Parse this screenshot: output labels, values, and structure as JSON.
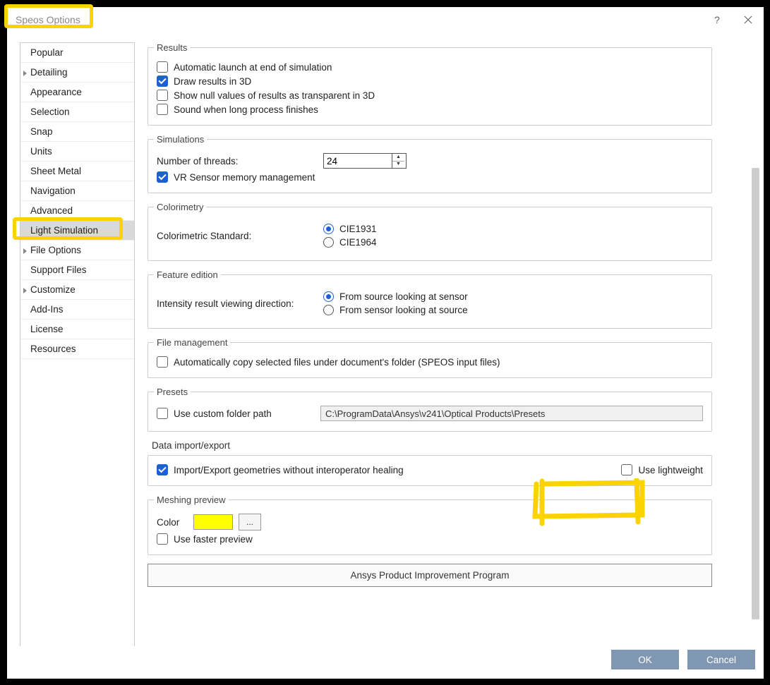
{
  "window": {
    "title": "Speos Options"
  },
  "sidebar": {
    "items": [
      {
        "label": "Popular",
        "expandable": false
      },
      {
        "label": "Detailing",
        "expandable": true
      },
      {
        "label": "Appearance",
        "expandable": false
      },
      {
        "label": "Selection",
        "expandable": false
      },
      {
        "label": "Snap",
        "expandable": false
      },
      {
        "label": "Units",
        "expandable": false
      },
      {
        "label": "Sheet Metal",
        "expandable": false
      },
      {
        "label": "Navigation",
        "expandable": false
      },
      {
        "label": "Advanced",
        "expandable": false
      },
      {
        "label": "Light Simulation",
        "expandable": false,
        "selected": true
      },
      {
        "label": "File Options",
        "expandable": true
      },
      {
        "label": "Support Files",
        "expandable": false
      },
      {
        "label": "Customize",
        "expandable": true
      },
      {
        "label": "Add-Ins",
        "expandable": false
      },
      {
        "label": "License",
        "expandable": false
      },
      {
        "label": "Resources",
        "expandable": false
      }
    ]
  },
  "results": {
    "legend": "Results",
    "auto_launch": "Automatic launch at end of simulation",
    "draw_3d": "Draw results in 3D",
    "null_transparent": "Show null values of results as transparent in 3D",
    "sound": "Sound when long process finishes"
  },
  "simulations": {
    "legend": "Simulations",
    "threads_label": "Number of threads:",
    "threads_value": "24",
    "vr_sensor": "VR Sensor memory management"
  },
  "colorimetry": {
    "legend": "Colorimetry",
    "std_label": "Colorimetric Standard:",
    "opt1": "CIE1931",
    "opt2": "CIE1964"
  },
  "feature": {
    "legend": "Feature edition",
    "dir_label": "Intensity result viewing direction:",
    "opt1": "From source looking at sensor",
    "opt2": "From sensor looking at source"
  },
  "filemgmt": {
    "legend": "File management",
    "auto_copy": "Automatically copy selected files under document's folder (SPEOS input files)"
  },
  "presets": {
    "legend": "Presets",
    "custom_path": "Use custom folder path",
    "path_value": "C:\\ProgramData\\Ansys\\v241\\Optical Products\\Presets"
  },
  "dataio": {
    "heading": "Data import/export",
    "import_export": "Import/Export geometries without interoperator healing",
    "lightweight": "Use lightweight"
  },
  "meshing": {
    "legend": "Meshing preview",
    "color_label": "Color",
    "color_value": "#FFFF00",
    "browse": "...",
    "faster": "Use faster preview"
  },
  "improve_btn": "Ansys Product Improvement Program",
  "footer": {
    "ok": "OK",
    "cancel": "Cancel"
  }
}
